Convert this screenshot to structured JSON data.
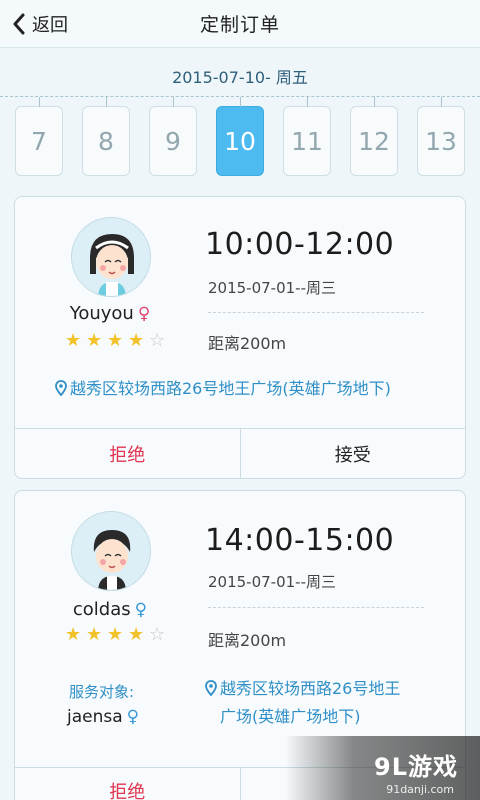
{
  "header": {
    "back_label": "返回",
    "title": "定制订单"
  },
  "date_strip": {
    "label": "2015-07-10- 周五",
    "days": [
      "7",
      "8",
      "9",
      "10",
      "11",
      "12",
      "13"
    ],
    "selected": "10"
  },
  "orders": [
    {
      "name": "Youyou",
      "gender": "♀",
      "rating": 4,
      "max_rating": 5,
      "time": "10:00-12:00",
      "date": "2015-07-01--周三",
      "distance": "距离200m",
      "address": "越秀区较场西路26号地王广场(英雄广场地下)",
      "reject_label": "拒绝",
      "accept_label": "接受"
    },
    {
      "name": "coldas",
      "gender": "♀",
      "rating": 4,
      "max_rating": 5,
      "time": "14:00-15:00",
      "date": "2015-07-01--周三",
      "distance": "距离200m",
      "serve_label": "服务对象:",
      "serve_name": "jaensa",
      "serve_gender": "♀",
      "address_line1": "越秀区较场西路26号地王",
      "address_line2": "广场(英雄广场地下)",
      "reject_label": "拒绝"
    }
  ],
  "watermark": {
    "logo": "9L游戏",
    "url": "91danji.com"
  },
  "colors": {
    "accent": "#4dbbf0",
    "reject": "#e0344f",
    "link": "#2f8fc6",
    "star": "#f2c22a"
  },
  "icons": [
    "chevron-left-icon",
    "location-pin-icon",
    "star-icon",
    "female-icon"
  ]
}
